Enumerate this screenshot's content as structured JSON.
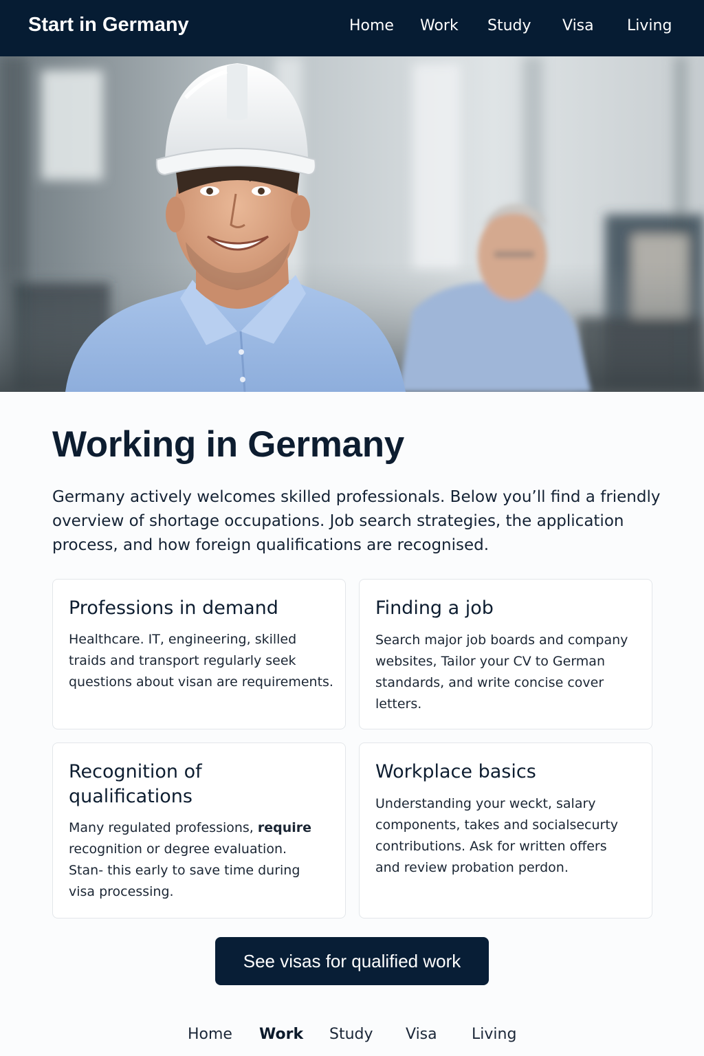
{
  "header": {
    "brand": "Start in Germany",
    "nav": [
      "Home",
      "Work",
      "Study",
      "Visa",
      "Living"
    ]
  },
  "hero": {
    "image_alt": "Smiling worker in a white hard hat and blue shirt in a factory, with a colleague in the blurred background"
  },
  "main": {
    "title": "Working in Germany",
    "intro": "Germany actively welcomes skilled professionals. Below you’ll find a friendly overview of shortage occupations. Job search strategies, the application process, and how foreign qualifications are recognised.",
    "cards": [
      {
        "title": "Professions in demand",
        "body": "Healthcare. IT, engineering, skilled traids and transport regularly seek questions about visan are requirements."
      },
      {
        "title": "Finding a job",
        "body": "Search major job  boards and company websites, Tailor your CV to German standards, and write concise cover letters."
      },
      {
        "title": "Recognition of qualifications",
        "body_before": "Many regulated professions, ",
        "body_bold": "require",
        "body_after": " recognition or degree evaluation. Stan- this early to save time during visa processing."
      },
      {
        "title": "Workplace basics",
        "body": "Understanding your weckt, salary components, takes and socialsecurty contributions. Ask for written offers and review probation perdon."
      }
    ],
    "cta_label": "See visas for qualified work"
  },
  "footer": {
    "nav": [
      "Home",
      "Work",
      "Study",
      "Visa",
      "Living"
    ],
    "active": "Work"
  },
  "colors": {
    "nav_background": "#061c33",
    "cta_background": "#081e36",
    "page_background": "#fbfcfd",
    "card_border": "#e3e6ea"
  }
}
